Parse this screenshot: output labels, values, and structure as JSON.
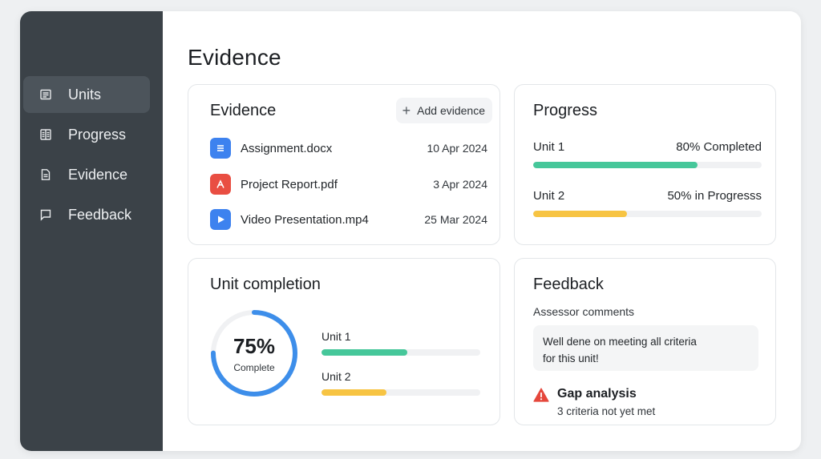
{
  "sidebar": {
    "items": [
      {
        "label": "Units",
        "icon": "list-icon",
        "active": true
      },
      {
        "label": "Progress",
        "icon": "chart-icon",
        "active": false
      },
      {
        "label": "Evidence",
        "icon": "document-icon",
        "active": false
      },
      {
        "label": "Feedback",
        "icon": "message-icon",
        "active": false
      }
    ]
  },
  "page": {
    "title": "Evidence"
  },
  "evidence_card": {
    "title": "Evidence",
    "add_label": "Add evidence",
    "files": [
      {
        "name": "Assignment.docx",
        "date": "10 Apr 2024",
        "icon": "doc-icon",
        "color": "#3d82ef"
      },
      {
        "name": "Project Report.pdf",
        "date": "3 Apr 2024",
        "icon": "pdf-icon",
        "color": "#e94e42"
      },
      {
        "name": "Video Presentation.mp4",
        "date": "25 Mar 2024",
        "icon": "video-icon",
        "color": "#3d82ef"
      }
    ]
  },
  "progress_card": {
    "title": "Progress",
    "units": [
      {
        "name": "Unit 1",
        "status": "80% Completed",
        "fraction": 0.72,
        "color": "#46c79a"
      },
      {
        "name": "Unit 2",
        "status": "50% in Progresss",
        "fraction": 0.41,
        "color": "#f7c443"
      }
    ]
  },
  "unit_completion": {
    "title": "Unit completion",
    "percent": "75%",
    "percent_value": 0.75,
    "subtitle": "Complete",
    "ring_color": "#3d8eea",
    "units": [
      {
        "name": "Unit 1",
        "fraction": 0.54,
        "color": "#46c79a"
      },
      {
        "name": "Unit 2",
        "fraction": 0.41,
        "color": "#f7c443"
      }
    ]
  },
  "feedback": {
    "title": "Feedback",
    "subtitle": "Assessor comments",
    "quote_line1": "Well dene on meeting all criteria",
    "quote_line2": "for this unit!",
    "gap_title": "Gap analysis",
    "gap_sub": "3 criteria not yet met",
    "warning_color": "#e5473c"
  }
}
